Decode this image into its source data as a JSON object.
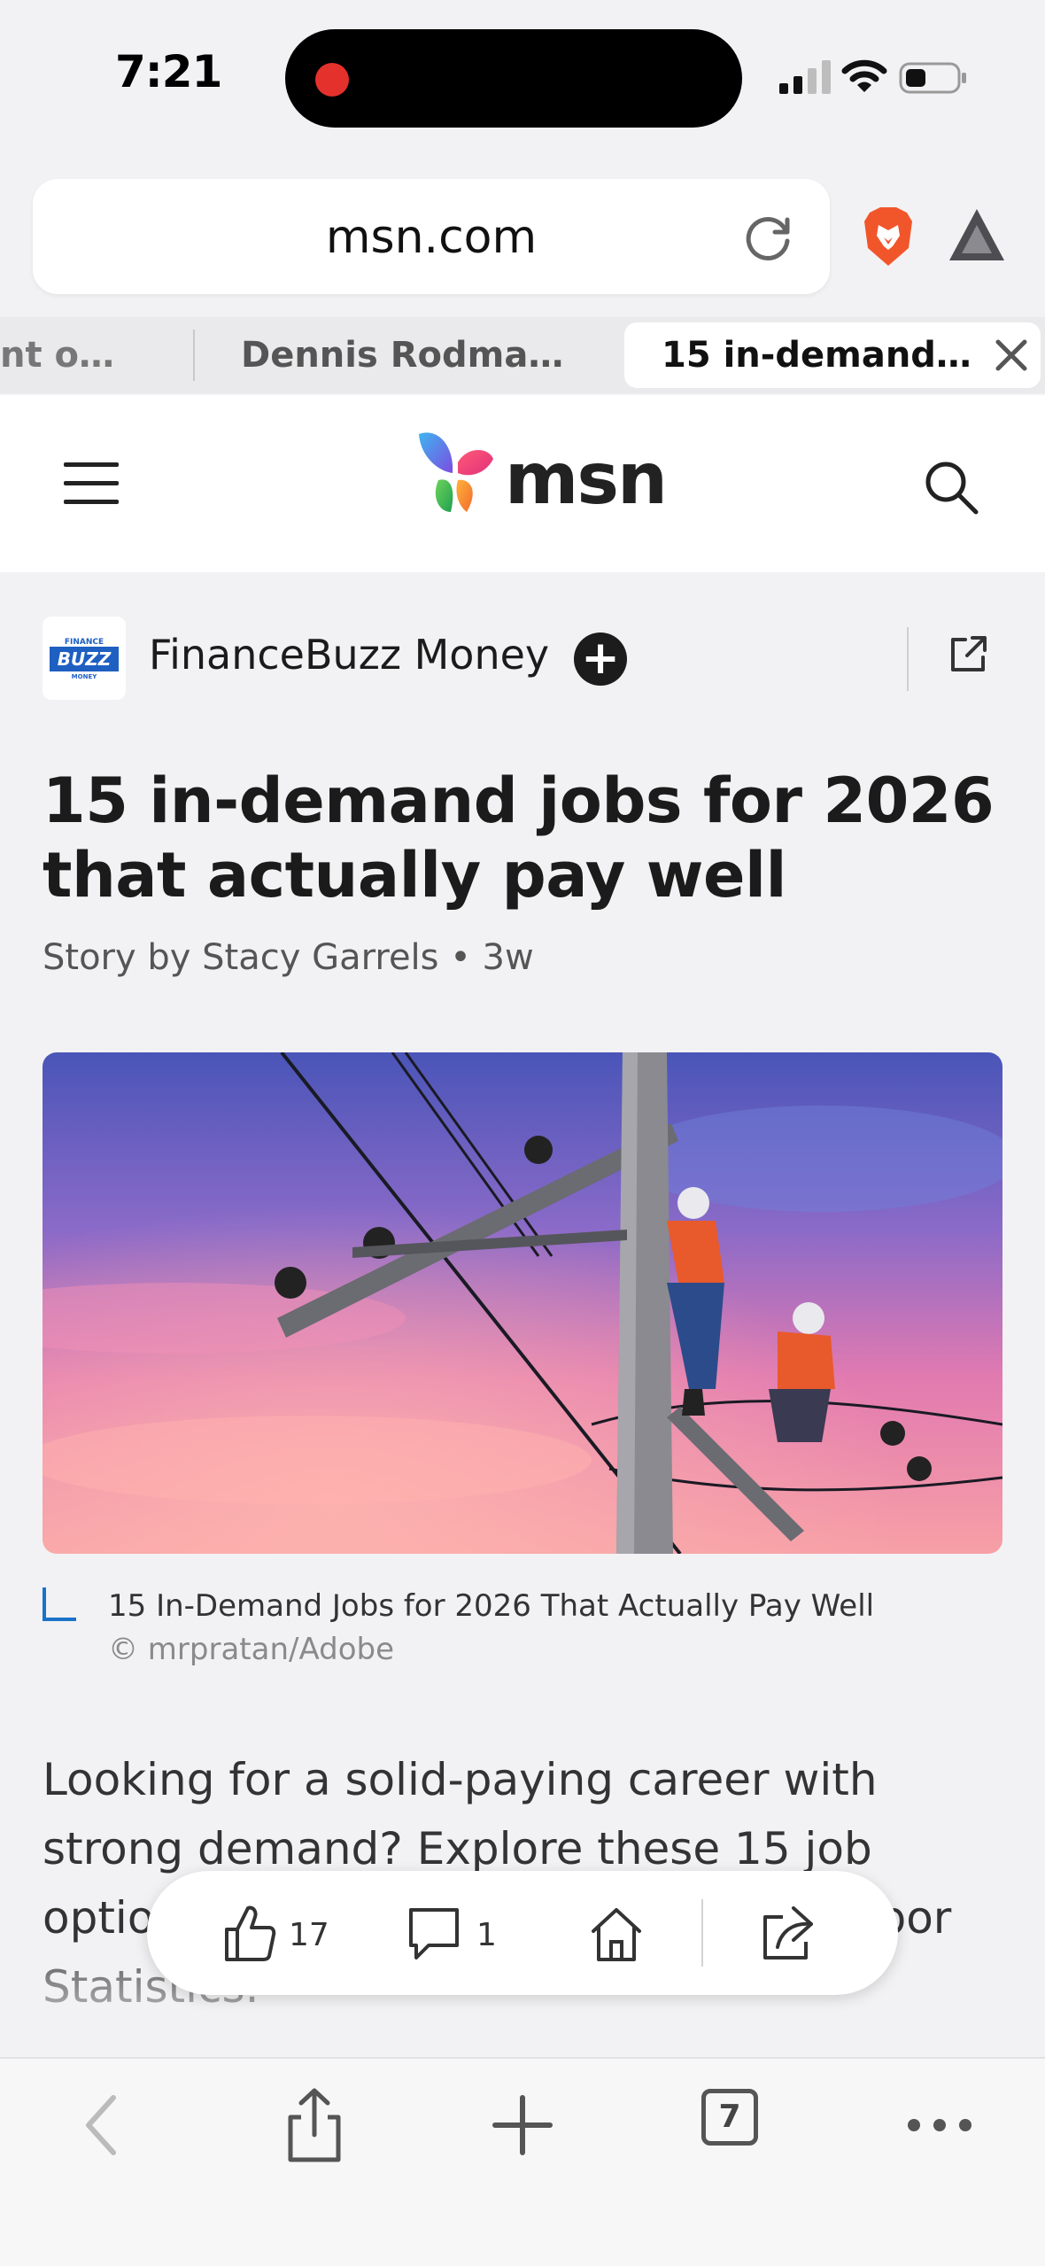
{
  "status_bar": {
    "time": "7:21",
    "recording": true
  },
  "browser": {
    "url": "msn.com",
    "tabs": [
      {
        "label": "nt o…",
        "active": false
      },
      {
        "label": "Dennis Rodma…",
        "active": false
      },
      {
        "label": "15 in-demand…",
        "active": true
      }
    ],
    "tab_count": "7"
  },
  "site": {
    "logo_text": "msn"
  },
  "publisher": {
    "name": "FinanceBuzz Money",
    "logo_lines": [
      "FINANCE",
      "BUZZ",
      "MONEY"
    ]
  },
  "article": {
    "title": "15 in-demand jobs for 2026 that actually pay well",
    "byline": "Story by Stacy Garrels • 3w",
    "image_caption": "15 In-Demand Jobs for 2026 That Actually Pay Well",
    "image_credit": "© mrpratan/Adobe",
    "body_preview": "Looking for a solid-paying career with strong demand? Explore these 15 job options that show … the Bureau of Labor Statistics."
  },
  "actions": {
    "likes": "17",
    "comments": "1"
  },
  "colors": {
    "brave_orange": "#f1562b",
    "record_red": "#e5312b",
    "caption_accent": "#1a73c8"
  }
}
